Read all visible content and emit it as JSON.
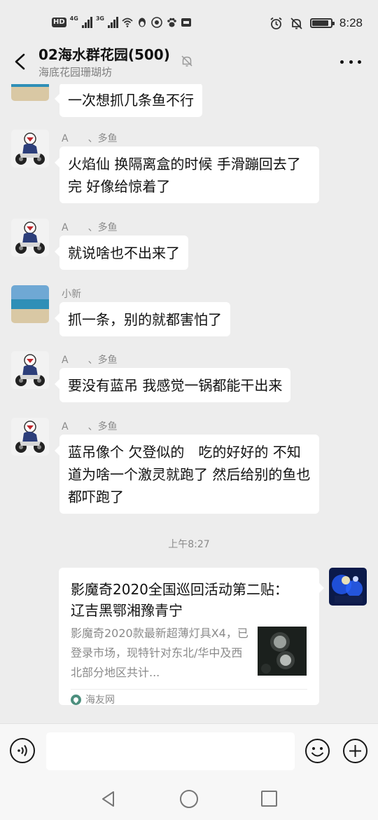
{
  "status_bar": {
    "hd_label": "HD",
    "network_1": "4G",
    "network_2": "3G",
    "time": "8:28",
    "battery_level": 0.9
  },
  "header": {
    "title": "02海水群花园(500)",
    "subtitle": "海底花园珊瑚坊",
    "icons": [
      "back-arrow-icon",
      "mute-bell-icon",
      "more-icon"
    ]
  },
  "messages": [
    {
      "sender": "",
      "avatar": "beach-avatar",
      "text": "一次想抓几条鱼不行"
    },
    {
      "sender": "A　　、多鱼",
      "avatar": "motorcycle-avatar",
      "text": "火焰仙 换隔离盒的时候 手滑蹦回去了　完 好像给惊着了"
    },
    {
      "sender": "A　　、多鱼",
      "avatar": "motorcycle-avatar",
      "text": "就说啥也不出来了"
    },
    {
      "sender": "小新",
      "avatar": "beach-avatar",
      "text": "抓一条，别的就都害怕了"
    },
    {
      "sender": "A　　、多鱼",
      "avatar": "motorcycle-avatar",
      "text": "要没有蓝吊 我感觉一锅都能干出来"
    },
    {
      "sender": "A　　、多鱼",
      "avatar": "motorcycle-avatar",
      "text": "蓝吊像个 欠登似的　吃的好好的 不知道为啥一个激灵就跑了 然后给别的鱼也都吓跑了"
    }
  ],
  "timestamp": "上午8:27",
  "shared_card": {
    "title": "影魔奇2020全国巡回活动第二贴： 辽吉黑鄂湘豫青宁",
    "description": "影魔奇2020款最新超薄灯具X4，已登录市场，现特针对东北/华中及西北部分地区共计...",
    "source": "海友网"
  },
  "input_bar": {
    "placeholder": "",
    "icons": [
      "voice-icon",
      "emoji-icon",
      "plus-icon"
    ]
  },
  "colors": {
    "background": "#ededed",
    "bubble": "#ffffff",
    "secondary_text": "#8a8a8a"
  }
}
